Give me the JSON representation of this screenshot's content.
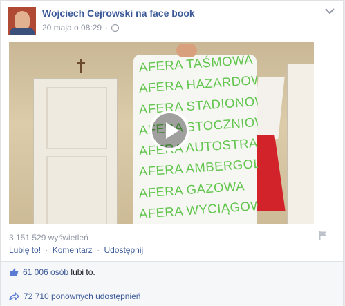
{
  "post": {
    "author": "Wojciech Cejrowski na face book",
    "date": "20 maja o 08:29",
    "privacy_icon": "globe-icon"
  },
  "video": {
    "poster_lines": [
      "AFERA TAŚMOWA",
      "AFERA HAZARDOWA",
      "AFERA STADIONOWA",
      "AFERA STOCZNIOWA",
      "AFERA AUTOSTRADOWA",
      "AFERA AMBERGOLD",
      "AFERA GAZOWA",
      "AFERA WYCIĄGOWA"
    ],
    "poster_text_color": "#62c54d",
    "play_icon": "play-icon"
  },
  "stats": {
    "views": "3 151 529 wyświetleń"
  },
  "actions": {
    "like": "Lubię to!",
    "comment": "Komentarz",
    "share": "Udostępnij",
    "separator": "·"
  },
  "ufi": {
    "likes_count": "61 006 osób",
    "likes_suffix": "lubi to.",
    "shares_text": "72 710 ponownych udostępnień"
  },
  "colors": {
    "link": "#3b5998",
    "meta": "#9197a3"
  }
}
